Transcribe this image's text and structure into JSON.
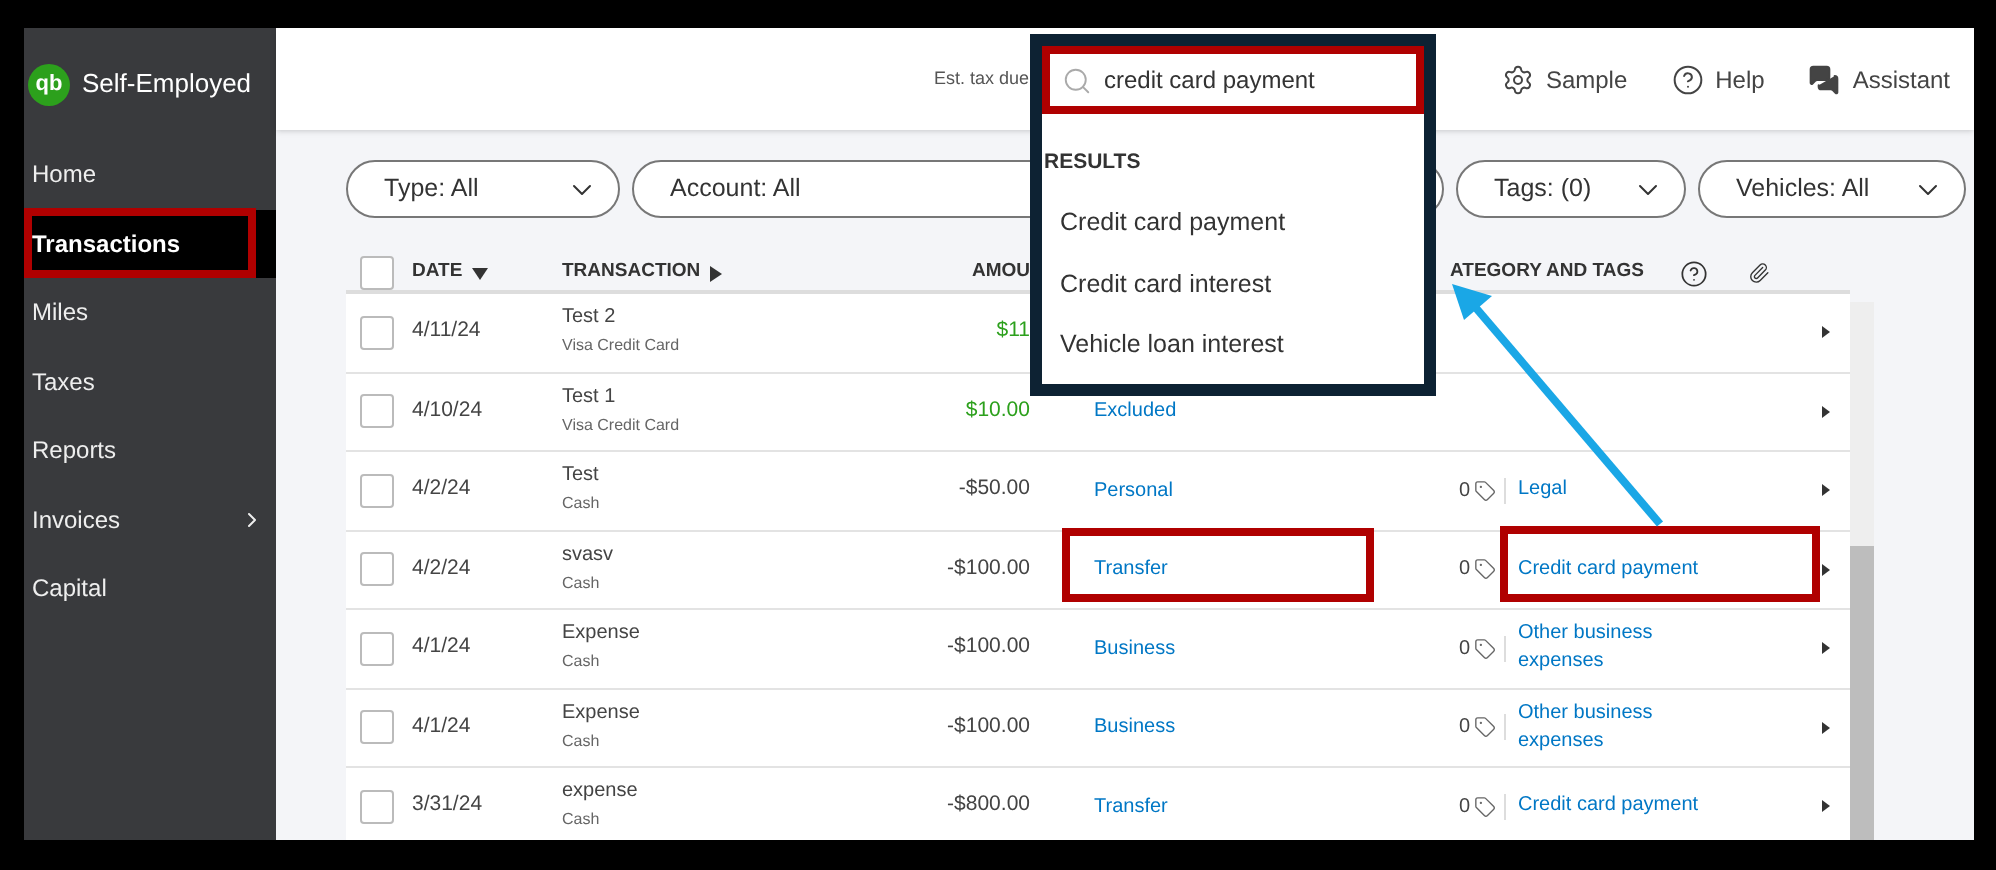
{
  "sidebar": {
    "brand": "Self-Employed",
    "logo": "qb",
    "items": [
      {
        "label": "Home",
        "selected": false
      },
      {
        "label": "Transactions",
        "selected": true
      },
      {
        "label": "Miles",
        "selected": false
      },
      {
        "label": "Taxes",
        "selected": false
      },
      {
        "label": "Reports",
        "selected": false
      },
      {
        "label": "Invoices",
        "selected": false,
        "submenu": true
      },
      {
        "label": "Capital",
        "selected": false
      }
    ]
  },
  "header": {
    "est_tax_label": "Est. tax due",
    "actions": [
      {
        "label": "Sample",
        "kind": "settings"
      },
      {
        "label": "Help",
        "kind": "help"
      },
      {
        "label": "Assistant",
        "kind": "chat"
      }
    ]
  },
  "filters": [
    {
      "label": "Type: All",
      "chevron": true
    },
    {
      "label": "Account: All"
    },
    {
      "label": "Tags: (0)",
      "chevron": true
    },
    {
      "label": "Vehicles: All",
      "chevron": true
    }
  ],
  "table": {
    "select_all_checked": false,
    "columns": [
      {
        "label": "DATE",
        "kind": "sorted"
      },
      {
        "label": "TRANSACTION",
        "kind": "expandable"
      },
      {
        "label": "AMOU",
        "kind": "plain"
      },
      {
        "label": "ATEGORY AND TAGS",
        "kind": "plain"
      }
    ],
    "rows": [
      {
        "checked": false,
        "date": "4/11/24",
        "name": "Test 2",
        "account": "Visa Credit Card",
        "amount": "$11",
        "income": true
      },
      {
        "checked": false,
        "date": "4/10/24",
        "name": "Test 1",
        "account": "Visa Credit Card",
        "amount": "$10.00",
        "income": true,
        "category": "Excluded"
      },
      {
        "checked": false,
        "date": "4/2/24",
        "name": "Test",
        "account": "Cash",
        "amount": "-$50.00",
        "income": false,
        "category": "Personal",
        "tags_count": "0",
        "detail": "Legal"
      },
      {
        "checked": false,
        "date": "4/2/24",
        "name": "svasv",
        "account": "Cash",
        "amount": "-$100.00",
        "income": false,
        "category": "Transfer",
        "tags_count": "0",
        "detail": "Credit card payment"
      },
      {
        "checked": false,
        "date": "4/1/24",
        "name": "Expense",
        "account": "Cash",
        "amount": "-$100.00",
        "income": false,
        "category": "Business",
        "tags_count": "0",
        "detail": "Other business expenses"
      },
      {
        "checked": false,
        "date": "4/1/24",
        "name": "Expense",
        "account": "Cash",
        "amount": "-$100.00",
        "income": false,
        "category": "Business",
        "tags_count": "0",
        "detail": "Other business expenses"
      },
      {
        "checked": false,
        "date": "3/31/24",
        "name": "expense",
        "account": "Cash",
        "amount": "-$800.00",
        "income": false,
        "category": "Transfer",
        "tags_count": "0",
        "detail": "Credit card payment"
      }
    ]
  },
  "search_popup": {
    "query": "credit card payment",
    "results_heading": "RESULTS",
    "results": [
      "Credit card payment",
      "Credit card interest",
      "Vehicle loan interest"
    ]
  }
}
